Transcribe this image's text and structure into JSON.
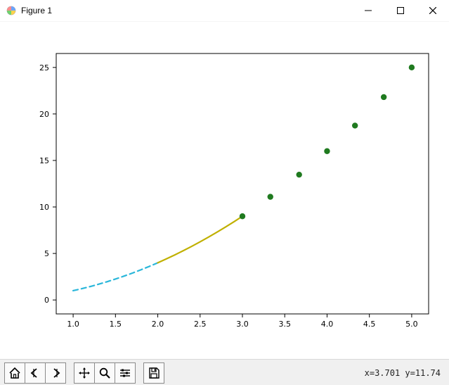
{
  "window": {
    "title": "Figure 1"
  },
  "status": {
    "coords": "x=3.701 y=11.74"
  },
  "chart_data": {
    "type": "line",
    "xlim": [
      0.8,
      5.2
    ],
    "ylim": [
      -1.5,
      26.5
    ],
    "xticks": [
      1.0,
      1.5,
      2.0,
      2.5,
      3.0,
      3.5,
      4.0,
      4.5,
      5.0
    ],
    "yticks": [
      0,
      5,
      10,
      15,
      20,
      25
    ],
    "xtick_labels": [
      "1.0",
      "1.5",
      "2.0",
      "2.5",
      "3.0",
      "3.5",
      "4.0",
      "4.5",
      "5.0"
    ],
    "ytick_labels": [
      "0",
      "5",
      "10",
      "15",
      "20",
      "25"
    ],
    "series": [
      {
        "name": "dashed-cyan",
        "style": "dashed",
        "color": "#2bb7da",
        "x": [
          1.0,
          1.1,
          1.2,
          1.3,
          1.4,
          1.5,
          1.6,
          1.7,
          1.8,
          1.9,
          2.0
        ],
        "y": [
          1.0,
          1.21,
          1.44,
          1.69,
          1.96,
          2.25,
          2.56,
          2.89,
          3.24,
          3.61,
          4.0
        ]
      },
      {
        "name": "solid-olive",
        "style": "solid",
        "color": "#c0b000",
        "x": [
          2.0,
          2.1,
          2.2,
          2.3,
          2.4,
          2.5,
          2.6,
          2.7,
          2.8,
          2.9,
          3.0
        ],
        "y": [
          4.0,
          4.41,
          4.84,
          5.29,
          5.76,
          6.25,
          6.76,
          7.29,
          7.84,
          8.41,
          9.0
        ]
      },
      {
        "name": "green-dots",
        "style": "scatter",
        "color": "#1f7a1f",
        "x": [
          3.0,
          3.33,
          3.67,
          4.0,
          4.33,
          4.67,
          5.0
        ],
        "y": [
          9.0,
          11.09,
          13.47,
          16.0,
          18.75,
          21.81,
          25.0
        ]
      }
    ],
    "title": "",
    "xlabel": "",
    "ylabel": ""
  }
}
